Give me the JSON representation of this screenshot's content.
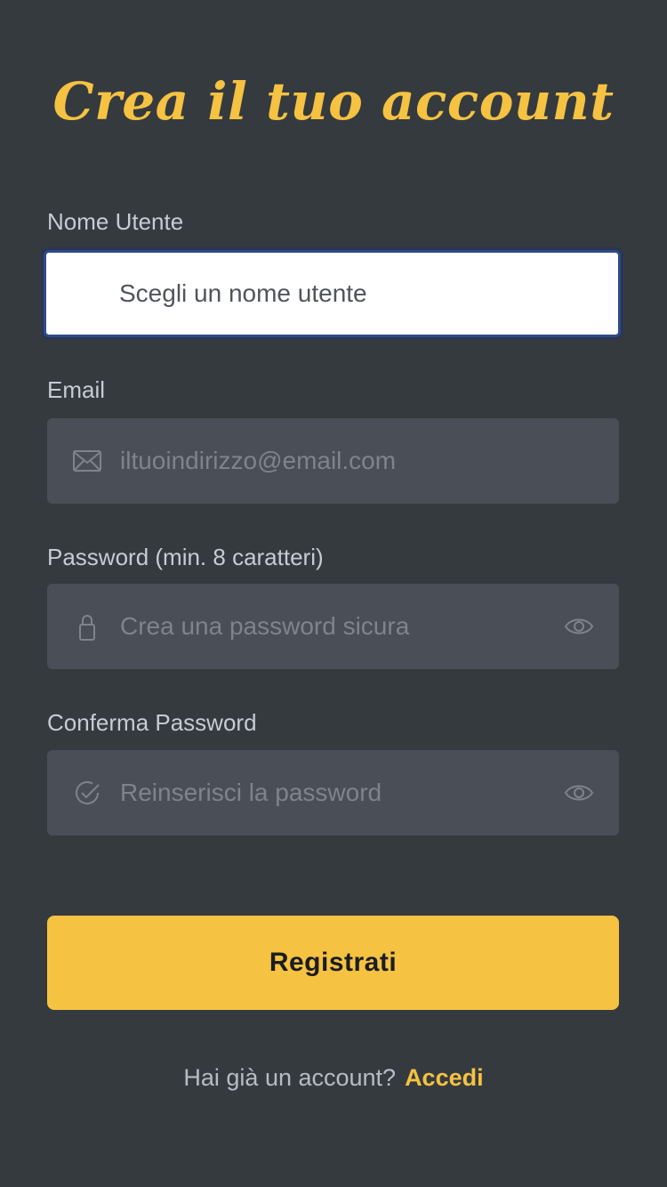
{
  "title": "Crea il tuo account",
  "fields": {
    "username": {
      "label": "Nome Utente",
      "placeholder": "Scegli un nome utente",
      "icon": "user-icon"
    },
    "email": {
      "label": "Email",
      "placeholder": "iltuoindirizzo@email.com",
      "icon": "envelope-icon"
    },
    "password": {
      "label": "Password (min. 8 caratteri)",
      "placeholder": "Crea una password sicura",
      "icon": "lock-icon",
      "toggle_icon": "eye-icon"
    },
    "confirm": {
      "label": "Conferma Password",
      "placeholder": "Reinserisci la password",
      "icon": "check-circle-icon",
      "toggle_icon": "eye-icon"
    }
  },
  "submit_label": "Registrati",
  "footer": {
    "text": "Hai già un account?",
    "link": "Accedi"
  },
  "colors": {
    "background": "#353a3f",
    "accent": "#f5c242",
    "field_bg": "#4a4f57"
  }
}
